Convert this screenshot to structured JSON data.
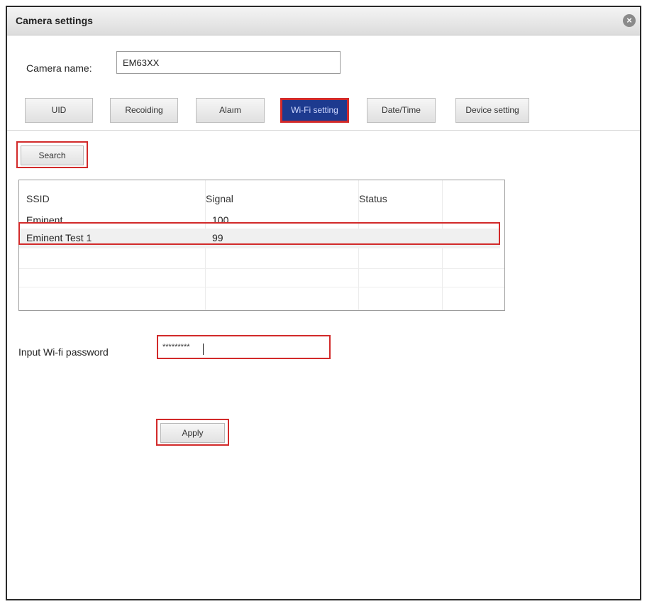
{
  "window": {
    "title": "Camera settings",
    "close_icon": "close-icon"
  },
  "camera": {
    "label": "Camera name:",
    "value": "EM63XX"
  },
  "tabs": [
    {
      "label": "UID",
      "active": false
    },
    {
      "label": "Recoiding",
      "active": false
    },
    {
      "label": "Alaım",
      "active": false
    },
    {
      "label": "Wi-Fi setting",
      "active": true
    },
    {
      "label": "Date/Time",
      "active": false
    },
    {
      "label": "Device setting",
      "active": false
    }
  ],
  "search": {
    "label": "Search"
  },
  "wifi_table": {
    "columns": [
      "SSID",
      "Signal",
      "Status"
    ],
    "rows": [
      {
        "ssid": "Eminent",
        "signal": "100",
        "status": ""
      },
      {
        "ssid": "Eminent Test 1",
        "signal": "99",
        "status": "",
        "selected": true
      }
    ]
  },
  "password": {
    "label": "Input Wi-fi password",
    "value": "*********"
  },
  "apply": {
    "label": "Apply"
  },
  "colors": {
    "highlight": "#d22a2a",
    "active_tab": "#1d3a8f"
  }
}
